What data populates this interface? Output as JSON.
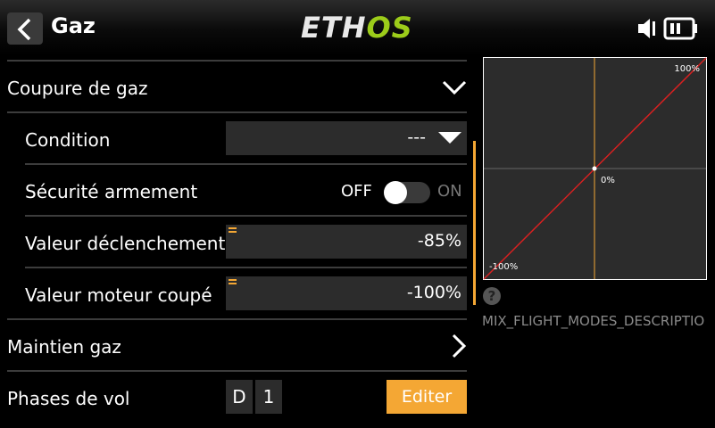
{
  "header": {
    "title": "Gaz",
    "logo_left": "ETH",
    "logo_right": "OS"
  },
  "sections": {
    "throttle_cut": "Coupure de gaz",
    "throttle_hold": "Maintien gaz",
    "flight_modes": "Phases de vol"
  },
  "fields": {
    "condition_label": "Condition",
    "condition_value": "---",
    "safety_label": "Sécurité armement",
    "safety_off": "OFF",
    "safety_on": "ON",
    "trigger_label": "Valeur déclenchement",
    "trigger_value": "-85%",
    "cut_label": "Valeur moteur coupé",
    "cut_value": "-100%"
  },
  "phases": {
    "boxes": [
      "D",
      "1"
    ],
    "edit_label": "Editer"
  },
  "graph": {
    "top_label": "100%",
    "center_label": "0%",
    "bottom_label": "-100%"
  },
  "help": {
    "icon_text": "?",
    "description": "MIX_FLIGHT_MODES_DESCRIPTIO"
  },
  "colors": {
    "accent": "#f4a734",
    "logo_green": "#9ccc1a",
    "curve": "#d92020"
  }
}
